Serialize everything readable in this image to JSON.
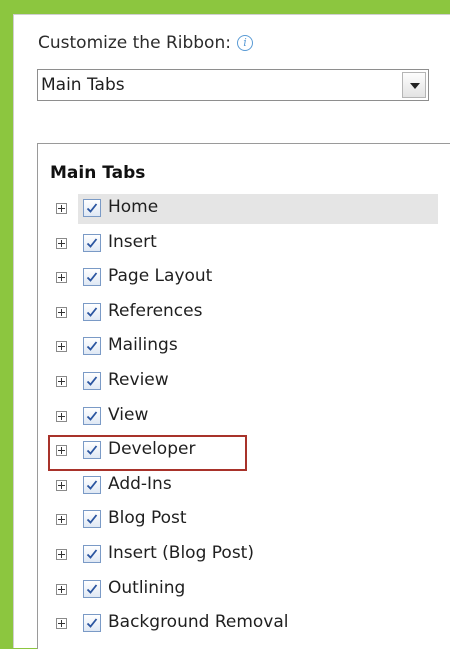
{
  "ribbon": {
    "heading": "Customize the Ribbon:",
    "info_icon": "info-icon",
    "dropdown": {
      "selected": "Main Tabs",
      "icon": "chevron-down-icon"
    }
  },
  "tree": {
    "header": "Main Tabs",
    "selected_item": "Home",
    "highlighted_item": "Developer",
    "highlight_color": "#a8322a",
    "items": [
      {
        "label": "Home",
        "checked": true
      },
      {
        "label": "Insert",
        "checked": true
      },
      {
        "label": "Page Layout",
        "checked": true
      },
      {
        "label": "References",
        "checked": true
      },
      {
        "label": "Mailings",
        "checked": true
      },
      {
        "label": "Review",
        "checked": true
      },
      {
        "label": "View",
        "checked": true
      },
      {
        "label": "Developer",
        "checked": true
      },
      {
        "label": "Add-Ins",
        "checked": true
      },
      {
        "label": "Blog Post",
        "checked": true
      },
      {
        "label": "Insert (Blog Post)",
        "checked": true
      },
      {
        "label": "Outlining",
        "checked": true
      },
      {
        "label": "Background Removal",
        "checked": true
      }
    ]
  }
}
